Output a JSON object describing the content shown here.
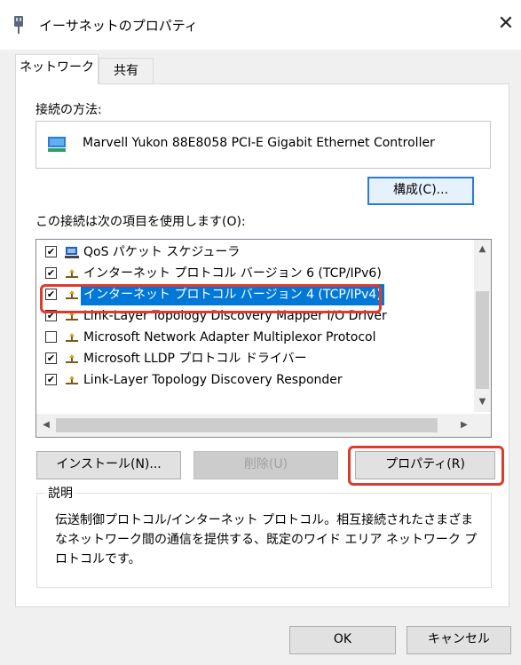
{
  "window": {
    "title": "イーサネットのプロパティ",
    "close_glyph": "✕"
  },
  "tabs": [
    {
      "label": "ネットワーク",
      "active": true
    },
    {
      "label": "共有",
      "active": false
    }
  ],
  "connect_using": {
    "label": "接続の方法:",
    "adapter": "Marvell Yukon 88E8058 PCI-E Gigabit Ethernet Controller",
    "configure_button": "構成(C)..."
  },
  "components": {
    "label": "この接続は次の項目を使用します(O):",
    "items": [
      {
        "checked": true,
        "icon": "qos-scheduler-icon",
        "label": "QoS パケット スケジューラ"
      },
      {
        "checked": true,
        "icon": "protocol-icon",
        "label": "インターネット プロトコル バージョン 6 (TCP/IPv6)"
      },
      {
        "checked": true,
        "icon": "protocol-icon",
        "label": "インターネット プロトコル バージョン 4 (TCP/IPv4)",
        "selected": true
      },
      {
        "checked": true,
        "icon": "protocol-icon",
        "label": "Link-Layer Topology Discovery Mapper I/O Driver"
      },
      {
        "checked": false,
        "icon": "protocol-icon",
        "label": "Microsoft Network Adapter Multiplexor Protocol"
      },
      {
        "checked": true,
        "icon": "protocol-icon",
        "label": "Microsoft LLDP プロトコル ドライバー"
      },
      {
        "checked": true,
        "icon": "protocol-icon",
        "label": "Link-Layer Topology Discovery Responder"
      }
    ],
    "check_glyph": "✔",
    "scroll_up": "▲",
    "scroll_down": "▼",
    "scroll_left": "◀",
    "scroll_right": "▶"
  },
  "actions": {
    "install": "インストール(N)...",
    "uninstall": "削除(U)",
    "properties": "プロパティ(R)"
  },
  "description": {
    "title": "説明",
    "text": "伝送制御プロトコル/インターネット プロトコル。相互接続されたさまざまなネットワーク間の通信を提供する、既定のワイド エリア ネットワーク プロトコルです。"
  },
  "footer": {
    "ok": "OK",
    "cancel": "キャンセル"
  },
  "colors": {
    "selection": "#0078d7",
    "highlight": "#e03a2a",
    "focus_border": "#2e7cd1"
  }
}
